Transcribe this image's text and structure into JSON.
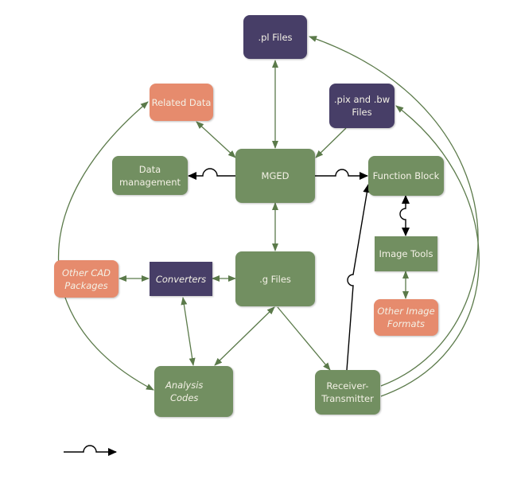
{
  "diagram": {
    "colors": {
      "process": "#728f61",
      "file": "#473e67",
      "external": "#e68b6d",
      "edge_green": "#5b7a4a",
      "edge_black": "#000000"
    },
    "nodes": {
      "pl_files": ".pl Files",
      "related_data": "Related Data",
      "pix_bw_files": ".pix and .bw\nFiles",
      "data_management": "Data\nmanagement",
      "mged": "MGED",
      "function_block": "Function Block",
      "image_tools": "Image Tools",
      "other_image_formats": "Other Image\nFormats",
      "other_cad_packages": "Other CAD\nPackages",
      "converters": "Converters",
      "g_files": ".g Files",
      "analysis_codes": "Analysis\nCodes",
      "receiver_transmitter": "Receiver-\nTransmitter"
    },
    "edges": [
      {
        "from": "mged",
        "to": "pl_files",
        "style": "green",
        "direction": "both"
      },
      {
        "from": "mged",
        "to": "related_data",
        "style": "green",
        "direction": "both"
      },
      {
        "from": "pix_bw_files",
        "to": "mged",
        "style": "green",
        "direction": "forward"
      },
      {
        "from": "mged",
        "to": "data_management",
        "style": "black-hop",
        "direction": "forward"
      },
      {
        "from": "mged",
        "to": "function_block",
        "style": "black-hop",
        "direction": "forward"
      },
      {
        "from": "mged",
        "to": "g_files",
        "style": "green",
        "direction": "both"
      },
      {
        "from": "function_block",
        "to": "image_tools",
        "style": "black-hop",
        "direction": "both"
      },
      {
        "from": "image_tools",
        "to": "other_image_formats",
        "style": "green",
        "direction": "both"
      },
      {
        "from": "other_cad_packages",
        "to": "converters",
        "style": "green",
        "direction": "both"
      },
      {
        "from": "converters",
        "to": "g_files",
        "style": "green",
        "direction": "both"
      },
      {
        "from": "converters",
        "to": "analysis_codes",
        "style": "green",
        "direction": "both"
      },
      {
        "from": "g_files",
        "to": "analysis_codes",
        "style": "green",
        "direction": "both"
      },
      {
        "from": "g_files",
        "to": "receiver_transmitter",
        "style": "green",
        "direction": "forward"
      },
      {
        "from": "receiver_transmitter",
        "to": "function_block",
        "style": "black-hop",
        "direction": "forward"
      },
      {
        "from": "receiver_transmitter",
        "to": "pl_files",
        "style": "green-curve",
        "direction": "forward"
      },
      {
        "from": "receiver_transmitter",
        "to": "pix_bw_files",
        "style": "green-curve",
        "direction": "forward"
      },
      {
        "from": "analysis_codes",
        "to": "related_data",
        "style": "green-curve",
        "direction": "both"
      }
    ],
    "legend": {
      "symbol": "line-jump-arrow"
    }
  }
}
